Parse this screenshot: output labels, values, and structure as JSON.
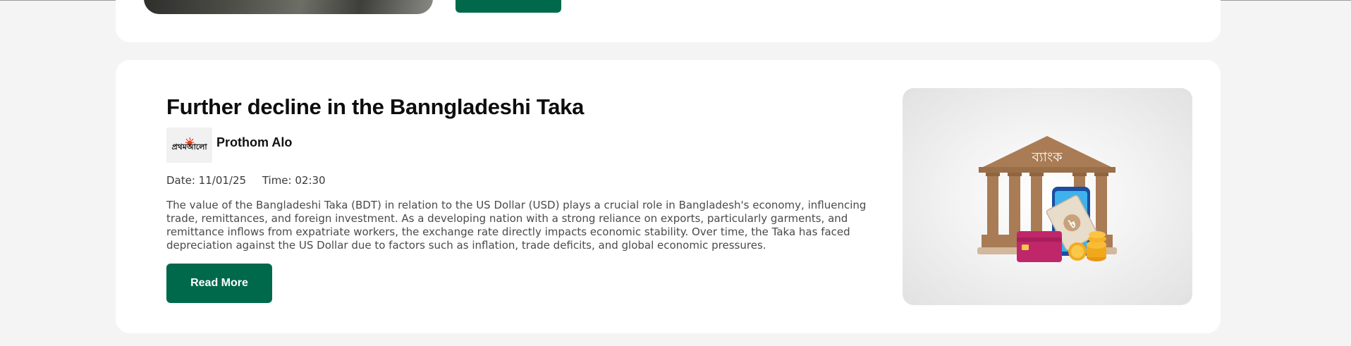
{
  "article": {
    "title": "Further decline in the Banngladeshi Taka",
    "publisher": {
      "name": "Prothom Alo",
      "logo_text": "প্রথমআলো"
    },
    "date_label": "Date: 11/01/25",
    "time_label": "Time: 02:30",
    "description": "The value of the Bangladeshi Taka (BDT) in relation to the US Dollar (USD) plays a crucial role in Bangladesh's economy, influencing trade, remittances, and foreign investment. As a developing nation with a strong reliance on exports, particularly garments, and remittance inflows from expatriate workers, the exchange rate directly impacts economic stability. Over time, the Taka has faced depreciation against the US Dollar due to factors such as inflation, trade deficits, and global economic pressures.",
    "read_more_label": "Read More",
    "image": {
      "bank_sign": "ব্যাংক",
      "currency_symbol": "৳"
    }
  },
  "colors": {
    "accent": "#00694b",
    "page_bg": "#f4f4f4",
    "card_bg": "#ffffff",
    "bank_brown": "#a97c55"
  }
}
